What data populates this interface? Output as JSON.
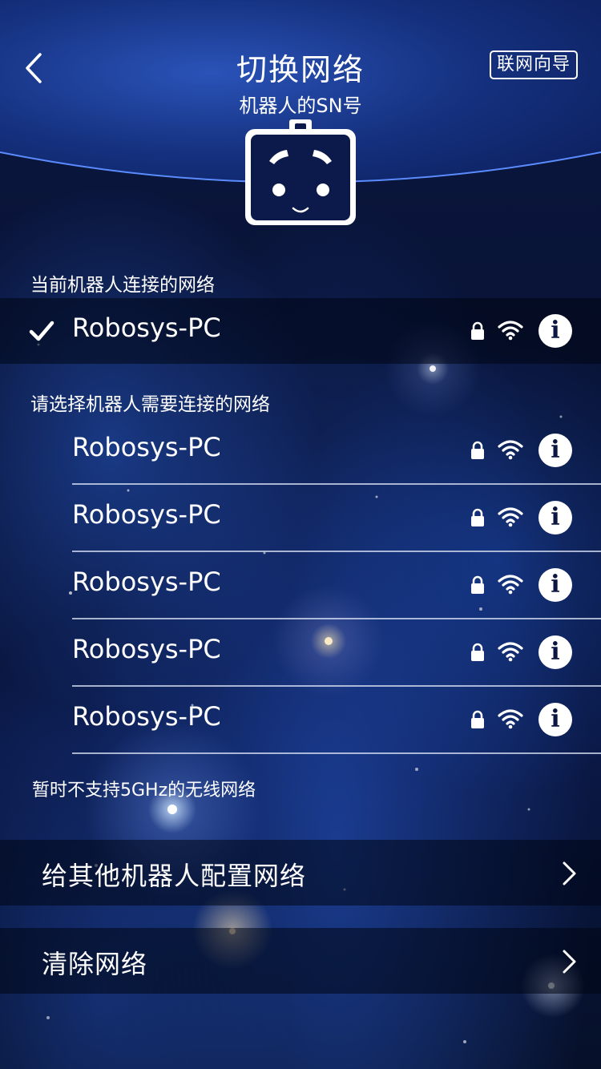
{
  "header": {
    "title": "切换网络",
    "subtitle": "机器人的SN号",
    "guide_label": "联网向导"
  },
  "current_section": {
    "label": "当前机器人连接的网络",
    "network": {
      "ssid": "Robosys-PC",
      "secured": true,
      "connected": true
    }
  },
  "available_section": {
    "label": "请选择机器人需要连接的网络",
    "networks": [
      {
        "ssid": "Robosys-PC",
        "secured": true
      },
      {
        "ssid": "Robosys-PC",
        "secured": true
      },
      {
        "ssid": "Robosys-PC",
        "secured": true
      },
      {
        "ssid": "Robosys-PC",
        "secured": true
      },
      {
        "ssid": "Robosys-PC",
        "secured": true
      }
    ]
  },
  "note": "暂时不支持5GHz的无线网络",
  "actions": [
    {
      "label": "给其他机器人配置网络"
    },
    {
      "label": "清除网络"
    }
  ],
  "icons": {
    "back": "chevron-left-icon",
    "check": "checkmark-icon",
    "lock": "lock-icon",
    "wifi": "wifi-icon",
    "info": "info-icon",
    "chevron": "chevron-right-icon",
    "avatar": "robot-face-icon"
  },
  "colors": {
    "accent_curve": "#5b8cff",
    "background": "#0b1740",
    "text": "#ffffff"
  }
}
